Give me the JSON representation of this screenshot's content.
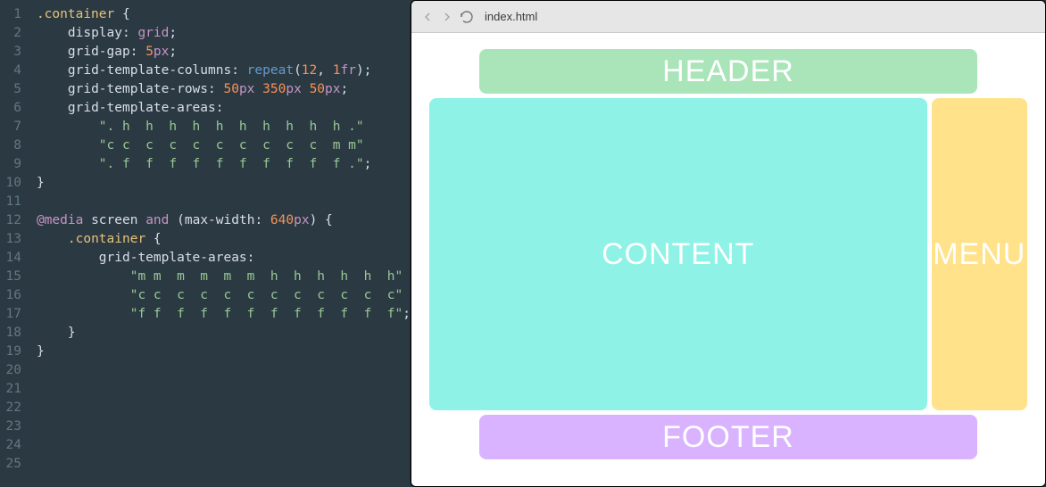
{
  "browser": {
    "url": "index.html"
  },
  "preview": {
    "header": "HEADER",
    "content": "CONTENT",
    "menu": "MENU",
    "footer": "FOOTER"
  },
  "editor": {
    "line_count": 25,
    "code_lines": [
      {
        "indent": 0,
        "tokens": [
          {
            "cls": "tok-sel",
            "t": ".container"
          },
          {
            "cls": "tok-punc",
            "t": " {"
          }
        ]
      },
      {
        "indent": 1,
        "tokens": [
          {
            "cls": "tok-prop",
            "t": "display"
          },
          {
            "cls": "tok-punc",
            "t": ": "
          },
          {
            "cls": "tok-val",
            "t": "grid"
          },
          {
            "cls": "tok-punc",
            "t": ";"
          }
        ]
      },
      {
        "indent": 1,
        "tokens": [
          {
            "cls": "tok-prop",
            "t": "grid-gap"
          },
          {
            "cls": "tok-punc",
            "t": ": "
          },
          {
            "cls": "tok-num",
            "t": "5"
          },
          {
            "cls": "tok-unit",
            "t": "px"
          },
          {
            "cls": "tok-punc",
            "t": ";"
          }
        ]
      },
      {
        "indent": 1,
        "tokens": [
          {
            "cls": "tok-prop",
            "t": "grid-template-columns"
          },
          {
            "cls": "tok-punc",
            "t": ": "
          },
          {
            "cls": "tok-fn",
            "t": "repeat"
          },
          {
            "cls": "tok-punc",
            "t": "("
          },
          {
            "cls": "tok-num",
            "t": "12"
          },
          {
            "cls": "tok-punc",
            "t": ", "
          },
          {
            "cls": "tok-num",
            "t": "1"
          },
          {
            "cls": "tok-unit",
            "t": "fr"
          },
          {
            "cls": "tok-punc",
            "t": ");"
          }
        ]
      },
      {
        "indent": 1,
        "tokens": [
          {
            "cls": "tok-prop",
            "t": "grid-template-rows"
          },
          {
            "cls": "tok-punc",
            "t": ": "
          },
          {
            "cls": "tok-num",
            "t": "50"
          },
          {
            "cls": "tok-unit",
            "t": "px"
          },
          {
            "cls": "tok-punc",
            "t": " "
          },
          {
            "cls": "tok-num",
            "t": "350"
          },
          {
            "cls": "tok-unit",
            "t": "px"
          },
          {
            "cls": "tok-punc",
            "t": " "
          },
          {
            "cls": "tok-num",
            "t": "50"
          },
          {
            "cls": "tok-unit",
            "t": "px"
          },
          {
            "cls": "tok-punc",
            "t": ";"
          }
        ]
      },
      {
        "indent": 1,
        "tokens": [
          {
            "cls": "tok-prop",
            "t": "grid-template-areas"
          },
          {
            "cls": "tok-punc",
            "t": ":"
          }
        ]
      },
      {
        "indent": 2,
        "tokens": [
          {
            "cls": "tok-str",
            "t": "\". h  h  h  h  h  h  h  h  h  h .\""
          }
        ]
      },
      {
        "indent": 2,
        "tokens": [
          {
            "cls": "tok-str",
            "t": "\"c c  c  c  c  c  c  c  c  c  m m\""
          }
        ]
      },
      {
        "indent": 2,
        "tokens": [
          {
            "cls": "tok-str",
            "t": "\". f  f  f  f  f  f  f  f  f  f .\""
          },
          {
            "cls": "tok-punc",
            "t": ";"
          }
        ]
      },
      {
        "indent": 0,
        "tokens": [
          {
            "cls": "tok-punc",
            "t": "}"
          }
        ]
      },
      {
        "indent": 0,
        "tokens": []
      },
      {
        "indent": 0,
        "tokens": [
          {
            "cls": "tok-media",
            "t": "@media"
          },
          {
            "cls": "tok-punc",
            "t": " screen "
          },
          {
            "cls": "tok-kw",
            "t": "and"
          },
          {
            "cls": "tok-punc",
            "t": " ("
          },
          {
            "cls": "tok-prop",
            "t": "max-width"
          },
          {
            "cls": "tok-punc",
            "t": ": "
          },
          {
            "cls": "tok-num",
            "t": "640"
          },
          {
            "cls": "tok-unit",
            "t": "px"
          },
          {
            "cls": "tok-punc",
            "t": ") {"
          }
        ]
      },
      {
        "indent": 1,
        "tokens": [
          {
            "cls": "tok-sel",
            "t": ".container"
          },
          {
            "cls": "tok-punc",
            "t": " {"
          }
        ]
      },
      {
        "indent": 2,
        "tokens": [
          {
            "cls": "tok-prop",
            "t": "grid-template-areas"
          },
          {
            "cls": "tok-punc",
            "t": ":"
          }
        ]
      },
      {
        "indent": 3,
        "tokens": [
          {
            "cls": "tok-str",
            "t": "\"m m  m  m  m  m  h  h  h  h  h  h\""
          }
        ]
      },
      {
        "indent": 3,
        "tokens": [
          {
            "cls": "tok-str",
            "t": "\"c c  c  c  c  c  c  c  c  c  c  c\""
          }
        ]
      },
      {
        "indent": 3,
        "tokens": [
          {
            "cls": "tok-str",
            "t": "\"f f  f  f  f  f  f  f  f  f  f  f\""
          },
          {
            "cls": "tok-punc",
            "t": ";"
          }
        ]
      },
      {
        "indent": 1,
        "tokens": [
          {
            "cls": "tok-punc",
            "t": "}"
          }
        ]
      },
      {
        "indent": 0,
        "tokens": [
          {
            "cls": "tok-punc",
            "t": "}"
          }
        ]
      },
      {
        "indent": 0,
        "tokens": []
      },
      {
        "indent": 0,
        "tokens": []
      },
      {
        "indent": 0,
        "tokens": []
      },
      {
        "indent": 0,
        "tokens": []
      },
      {
        "indent": 0,
        "tokens": []
      },
      {
        "indent": 0,
        "tokens": []
      }
    ]
  }
}
